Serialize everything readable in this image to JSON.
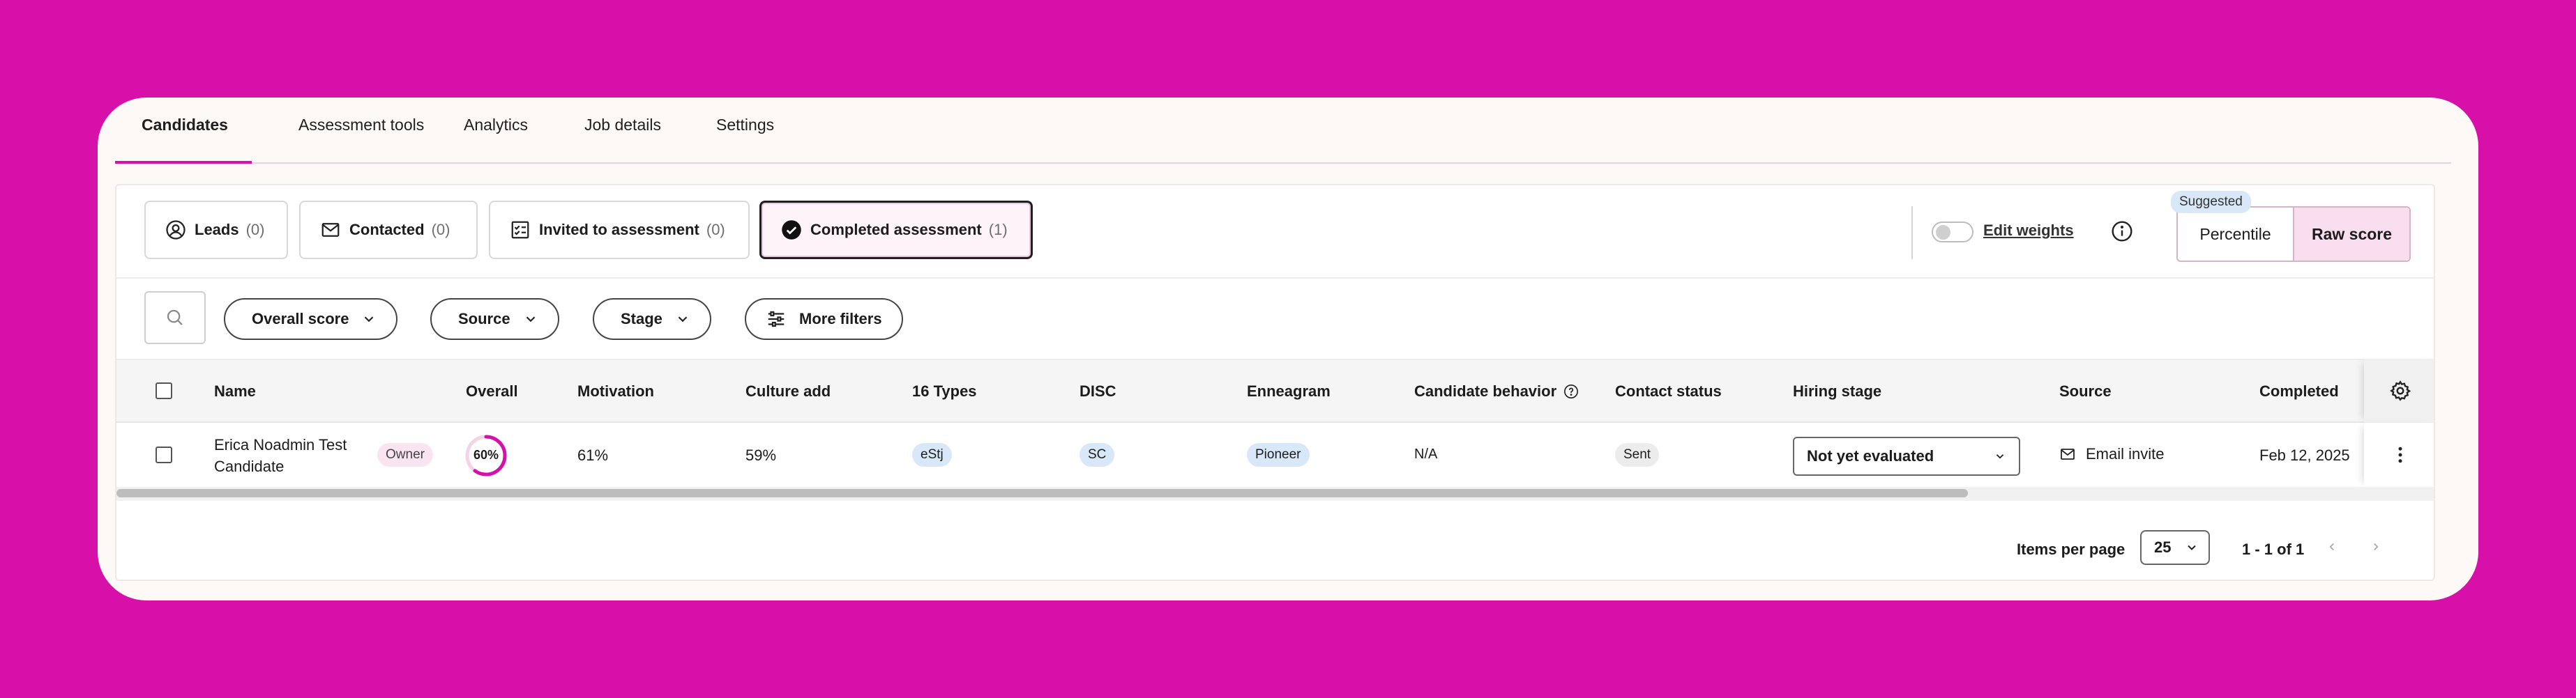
{
  "nav": {
    "tabs": [
      {
        "label": "Candidates",
        "active": true
      },
      {
        "label": "Assessment tools",
        "active": false
      },
      {
        "label": "Analytics",
        "active": false
      },
      {
        "label": "Job details",
        "active": false
      },
      {
        "label": "Settings",
        "active": false
      }
    ]
  },
  "stages": [
    {
      "label": "Leads",
      "count": "(0)",
      "icon": "user-circle-icon"
    },
    {
      "label": "Contacted",
      "count": "(0)",
      "icon": "mail-icon"
    },
    {
      "label": "Invited to assessment",
      "count": "(0)",
      "icon": "checklist-icon"
    },
    {
      "label": "Completed assessment",
      "count": "(1)",
      "icon": "check-circle-icon",
      "active": true
    }
  ],
  "weights": {
    "toggle_on": false,
    "edit_label": "Edit weights"
  },
  "score_mode": {
    "suggested_label": "Suggested",
    "options": [
      "Percentile",
      "Raw score"
    ],
    "selected": "Raw score"
  },
  "filters": {
    "chips": [
      "Overall score",
      "Source",
      "Stage"
    ],
    "more_label": "More filters"
  },
  "table": {
    "columns": [
      "Name",
      "Overall",
      "Motivation",
      "Culture add",
      "16 Types",
      "DISC",
      "Enneagram",
      "Candidate behavior",
      "Contact status",
      "Hiring stage",
      "Source",
      "Completed"
    ],
    "rows": [
      {
        "name_line1": "Erica Noadmin Test",
        "name_line2": "Candidate",
        "role_badge": "Owner",
        "overall": "60%",
        "overall_value": 0.6,
        "motivation": "61%",
        "culture_add": "59%",
        "types16": "eStj",
        "disc": "SC",
        "enneagram": "Pioneer",
        "candidate_behavior": "N/A",
        "contact_status": "Sent",
        "hiring_stage": "Not yet evaluated",
        "source": "Email invite",
        "completed": "Feb 12, 2025"
      }
    ]
  },
  "pagination": {
    "items_per_page_label": "Items per page",
    "items_per_page": "25",
    "range": "1 - 1 of 1"
  },
  "colors": {
    "background": "#d710aa",
    "accent": "#d710aa",
    "score_ring": "#d710aa"
  }
}
